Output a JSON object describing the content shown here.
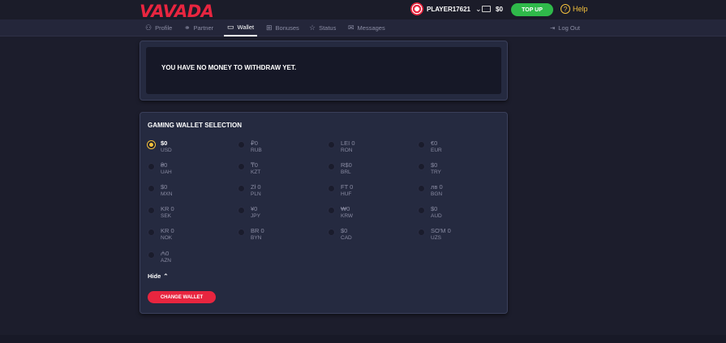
{
  "brand": {
    "logo": "VAVADA"
  },
  "header": {
    "username": "PLAYER17621",
    "balance": "$0",
    "topup_label": "TOP UP",
    "help_label": "Help"
  },
  "nav": {
    "tabs": [
      {
        "label": "Profile",
        "icon": "user-icon"
      },
      {
        "label": "Partner",
        "icon": "partner-icon"
      },
      {
        "label": "Wallet",
        "icon": "wallet-icon"
      },
      {
        "label": "Bonuses",
        "icon": "gift-icon"
      },
      {
        "label": "Status",
        "icon": "star-icon"
      },
      {
        "label": "Messages",
        "icon": "mail-icon"
      }
    ],
    "active_tab": "Wallet",
    "logout_label": "Log Out"
  },
  "withdraw": {
    "message": "YOU HAVE NO MONEY TO WITHDRAW YET."
  },
  "wallet_selection": {
    "title": "GAMING WALLET SELECTION",
    "selected": "USD",
    "options": [
      {
        "sym": "$0",
        "code": "USD"
      },
      {
        "sym": "₽0",
        "code": "RUB"
      },
      {
        "sym": "LEI 0",
        "code": "RON"
      },
      {
        "sym": "€0",
        "code": "EUR"
      },
      {
        "sym": "₴0",
        "code": "UAH"
      },
      {
        "sym": "₸0",
        "code": "KZT"
      },
      {
        "sym": "R$0",
        "code": "BRL"
      },
      {
        "sym": "$0",
        "code": "TRY"
      },
      {
        "sym": "$0",
        "code": "MXN"
      },
      {
        "sym": "Zł 0",
        "code": "PLN"
      },
      {
        "sym": "FT 0",
        "code": "HUF"
      },
      {
        "sym": "лв 0",
        "code": "BGN"
      },
      {
        "sym": "KR 0",
        "code": "SEK"
      },
      {
        "sym": "¥0",
        "code": "JPY"
      },
      {
        "sym": "₩0",
        "code": "KRW"
      },
      {
        "sym": "$0",
        "code": "AUD"
      },
      {
        "sym": "KR 0",
        "code": "NOK"
      },
      {
        "sym": "BR 0",
        "code": "BYN"
      },
      {
        "sym": "$0",
        "code": "CAD"
      },
      {
        "sym": "SO'M 0",
        "code": "UZS"
      },
      {
        "sym": "₼0",
        "code": "AZN"
      }
    ],
    "hide_label": "Hide",
    "change_label": "CHANGE WALLET"
  },
  "colors": {
    "accent": "#e8253f",
    "topup": "#2fb94a",
    "help": "#f5c23d",
    "selected_radio": "#f5c23d"
  }
}
